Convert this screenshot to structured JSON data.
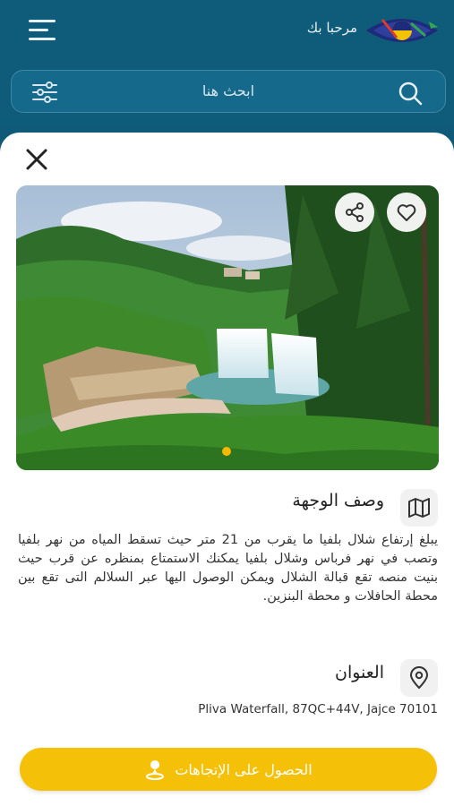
{
  "header": {
    "welcome_text": "مرحبا بك"
  },
  "search": {
    "placeholder": "ابحث هنا"
  },
  "destination": {
    "description_title": "وصف الوجهة",
    "description": "يبلغ إرتفاع شلال بلفيا ما يقرب من 21 متر حيث تسقط المياه من نهر بلفيا وتصب في نهر فرباس وشلال بلفيا يمكنك الاستمتاع بمنظره عن قرب حيث بنيت منصه تقع قبالة الشلال ويمكن الوصول اليها عبر السلالم التى تقع بين محطة الحافلات و محطة البنزين.",
    "address_title": "العنوان",
    "address": "Pliva Waterfall, 87QC+44V, Jajce 70101"
  },
  "carousel": {
    "active_index": 0,
    "count": 1
  },
  "actions": {
    "directions_label": "الحصول على الإتجاهات"
  },
  "icons": {
    "menu": "menu-icon",
    "search": "search-icon",
    "filter": "filter-icon",
    "close": "close-icon",
    "share": "share-icon",
    "favorite": "heart-icon",
    "map": "map-icon",
    "location": "location-pin-icon",
    "directions": "person-pin-icon"
  },
  "colors": {
    "header_bg": "#0f5b7a",
    "accent": "#f5c108",
    "indicator": "#f5b800"
  }
}
